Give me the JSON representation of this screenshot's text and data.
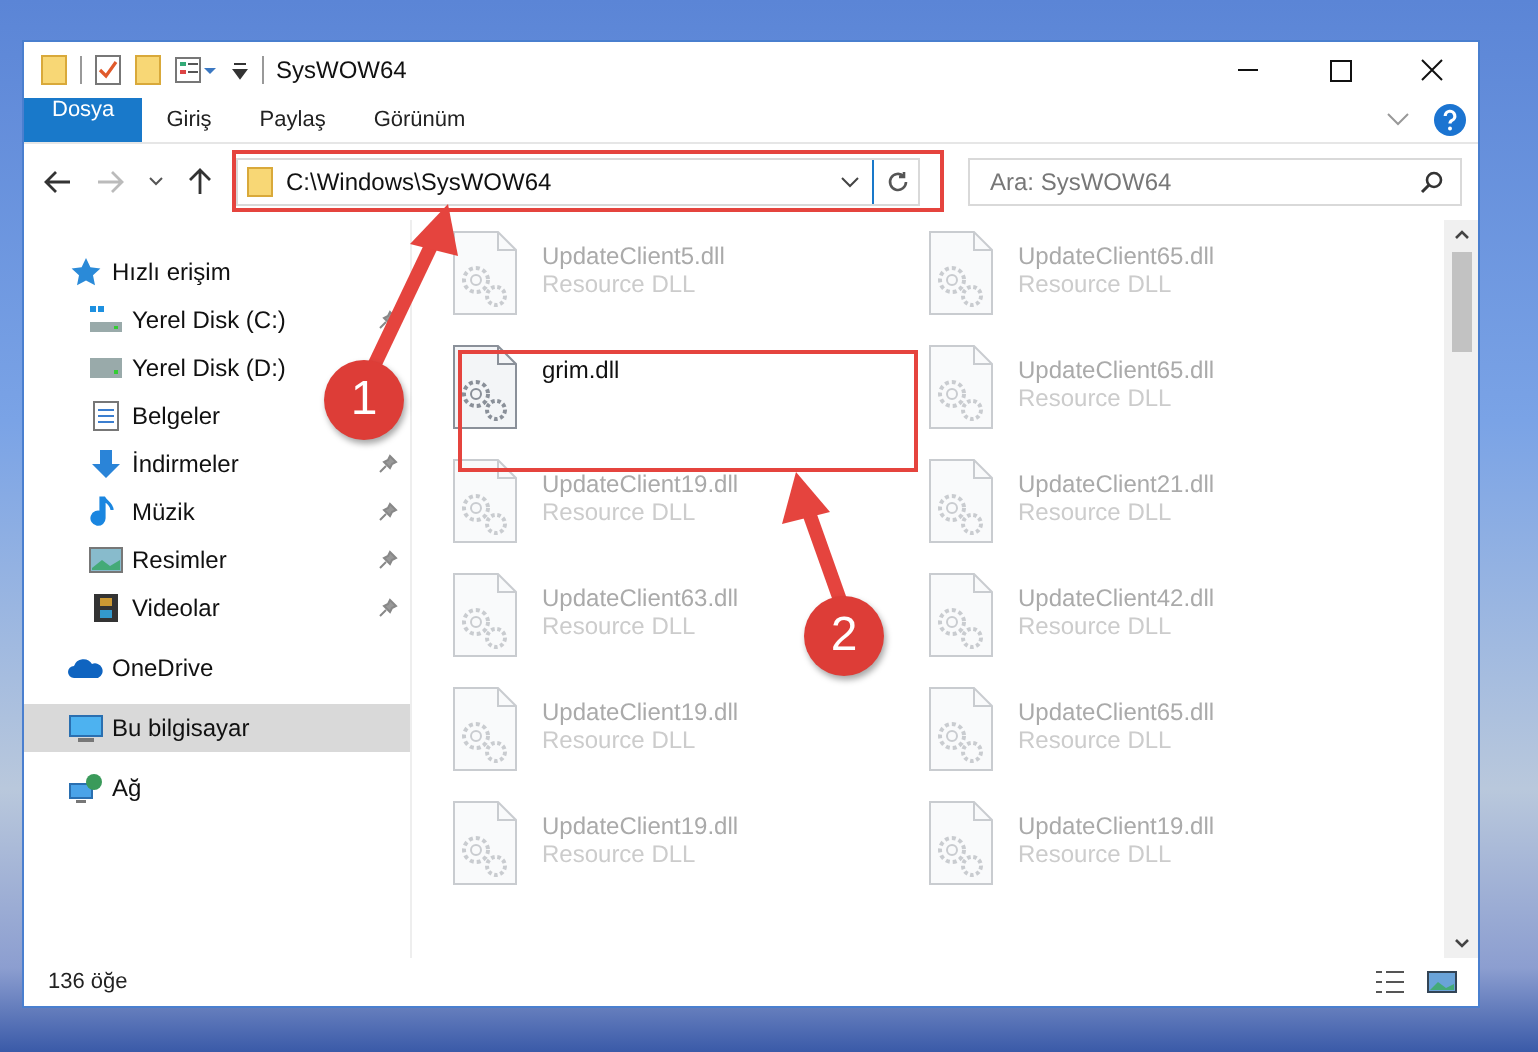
{
  "window": {
    "title": "SysWOW64"
  },
  "ribbon": {
    "tabs": [
      {
        "label": "Dosya",
        "selected": true
      },
      {
        "label": "Giriş",
        "selected": false
      },
      {
        "label": "Paylaş",
        "selected": false
      },
      {
        "label": "Görünüm",
        "selected": false
      }
    ]
  },
  "address_bar": {
    "path": "C:\\Windows\\SysWOW64"
  },
  "search": {
    "placeholder": "Ara: SysWOW64"
  },
  "navigation": {
    "items": [
      {
        "label": "Hızlı erişim",
        "kind": "star",
        "selected": false,
        "children": [
          {
            "label": "Yerel Disk (C:)",
            "kind": "windrive",
            "pinned": true
          },
          {
            "label": "Yerel Disk (D:)",
            "kind": "drive",
            "pinned": false
          },
          {
            "label": "Belgeler",
            "kind": "document",
            "pinned": false
          },
          {
            "label": "İndirmeler",
            "kind": "download",
            "pinned": true
          },
          {
            "label": "Müzik",
            "kind": "music",
            "pinned": true
          },
          {
            "label": "Resimler",
            "kind": "picture",
            "pinned": true
          },
          {
            "label": "Videolar",
            "kind": "video",
            "pinned": true
          }
        ]
      },
      {
        "label": "OneDrive",
        "kind": "cloud",
        "selected": false
      },
      {
        "label": "Bu bilgisayar",
        "kind": "computer",
        "selected": true
      },
      {
        "label": "Ağ",
        "kind": "network",
        "selected": false
      }
    ]
  },
  "files": [
    {
      "name": "UpdateClient5.dll",
      "type": "Resource DLL",
      "faded": true
    },
    {
      "name": "UpdateClient65.dll",
      "type": "Resource DLL",
      "faded": true
    },
    {
      "name": "grim.dll",
      "faded": false
    },
    {
      "name": "UpdateClient65.dll",
      "type": "Resource DLL",
      "faded": true
    },
    {
      "name": "UpdateClient19.dll",
      "type": "Resource DLL",
      "faded": true
    },
    {
      "name": "UpdateClient21.dll",
      "type": "Resource DLL",
      "faded": true
    },
    {
      "name": "UpdateClient63.dll",
      "type": "Resource DLL",
      "faded": true
    },
    {
      "name": "UpdateClient42.dll",
      "type": "Resource DLL",
      "faded": true
    },
    {
      "name": "UpdateClient19.dll",
      "type": "Resource DLL",
      "faded": true
    },
    {
      "name": "UpdateClient65.dll",
      "type": "Resource DLL",
      "faded": true
    },
    {
      "name": "UpdateClient19.dll",
      "type": "Resource DLL",
      "faded": true
    },
    {
      "name": "UpdateClient19.dll",
      "type": "Resource DLL",
      "faded": true
    }
  ],
  "status_bar": {
    "item_count": "136 öğe"
  },
  "annotations": {
    "steps": [
      {
        "number": "1"
      },
      {
        "number": "2"
      }
    ]
  }
}
